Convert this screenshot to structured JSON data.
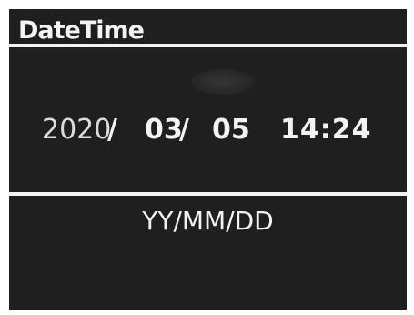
{
  "screen": {
    "title": "DateTime",
    "datetime": {
      "year": "2020",
      "slash": "/",
      "month": "03",
      "day": "05",
      "time": "14:24"
    },
    "format": "YY/MM/DD"
  },
  "colors": {
    "background": "#1f1f1f",
    "foreground": "#f3f3f3"
  }
}
